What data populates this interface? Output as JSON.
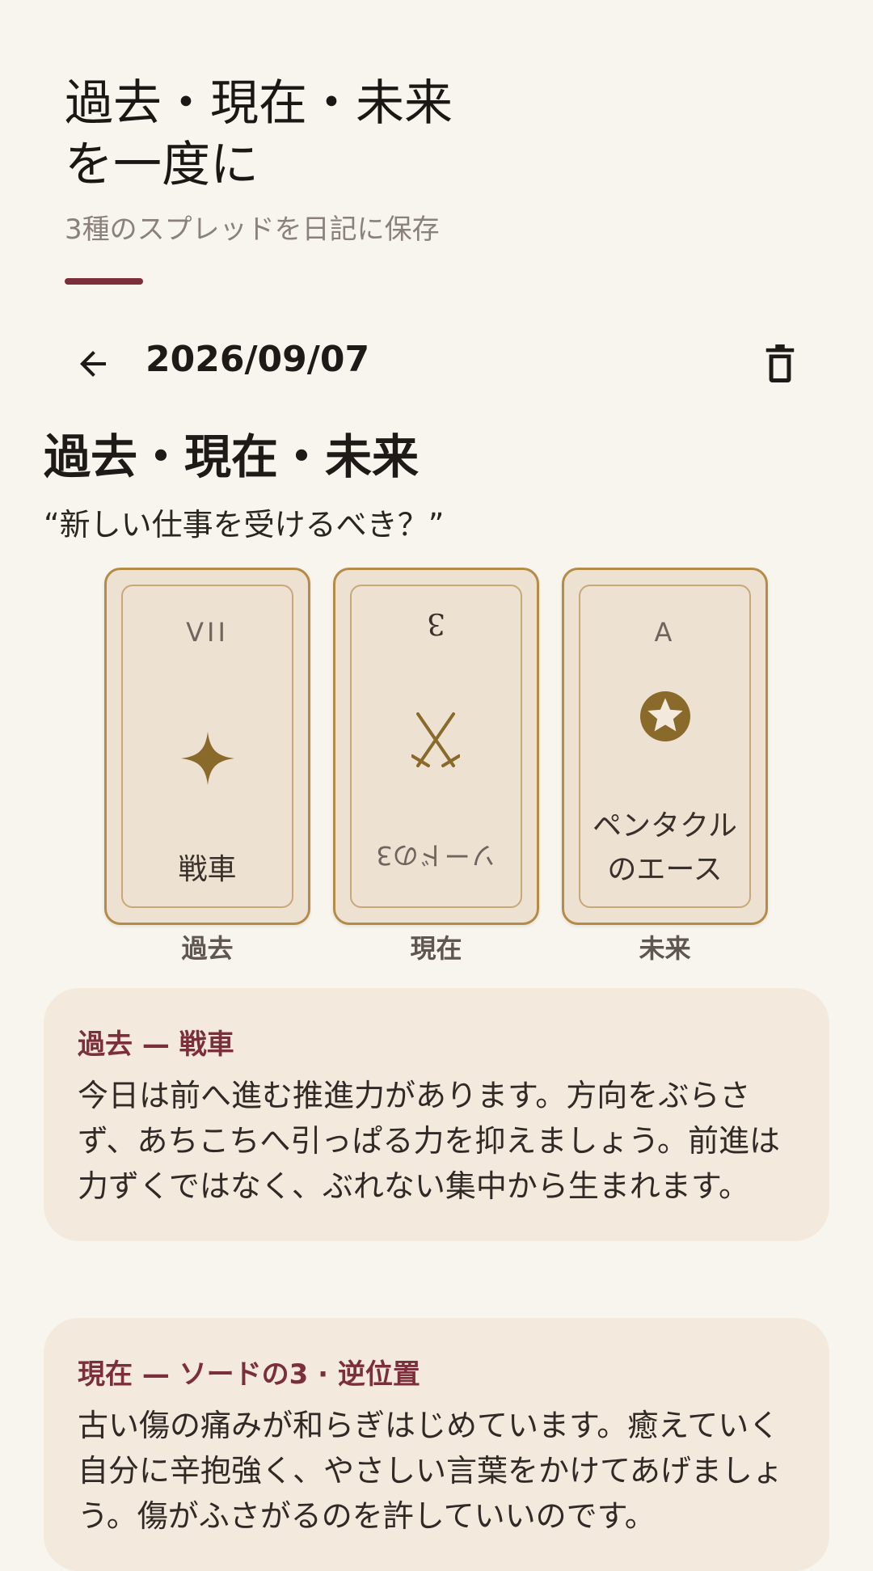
{
  "hero": {
    "title_line1": "過去・現在・未来",
    "title_line2": "を一度に",
    "subtitle": "3種のスプレッドを日記に保存"
  },
  "topbar": {
    "date": "2026/09/07",
    "back_icon": "arrow-left-icon",
    "delete_icon": "trash-icon"
  },
  "spread": {
    "title": "過去・現在・未来",
    "question": "“新しい仕事を受けるべき？”"
  },
  "cards": [
    {
      "number": "VII",
      "name": "戦車",
      "label": "過去",
      "reversed": false,
      "icon": "four-point-star-icon"
    },
    {
      "number": "ソードの3",
      "name": "3",
      "label": "現在",
      "reversed": true,
      "icon": "crossed-swords-icon"
    },
    {
      "number": "A",
      "name_line1": "ペンタクル",
      "name_line2": "のエース",
      "label": "未来",
      "reversed": false,
      "icon": "pentacle-icon"
    }
  ],
  "readings": [
    {
      "title": "過去 — 戦車",
      "text": "今日は前へ進む推進力があります。方向をぶらさず、あちこちへ引っぱる力を抑えましょう。前進は力ずくではなく、ぶれない集中から生まれます。"
    },
    {
      "title": "現在 — ソードの3 · 逆位置",
      "text": "古い傷の痛みが和らぎはじめています。癒えていく自分に辛抱強く、やさしい言葉をかけてあげましょう。傷がふさがるのを許していいのです。"
    }
  ],
  "colors": {
    "accent": "#7b2f3a",
    "gold": "#9a7330",
    "background": "#f8f4ee",
    "card": "#ede1d2"
  }
}
